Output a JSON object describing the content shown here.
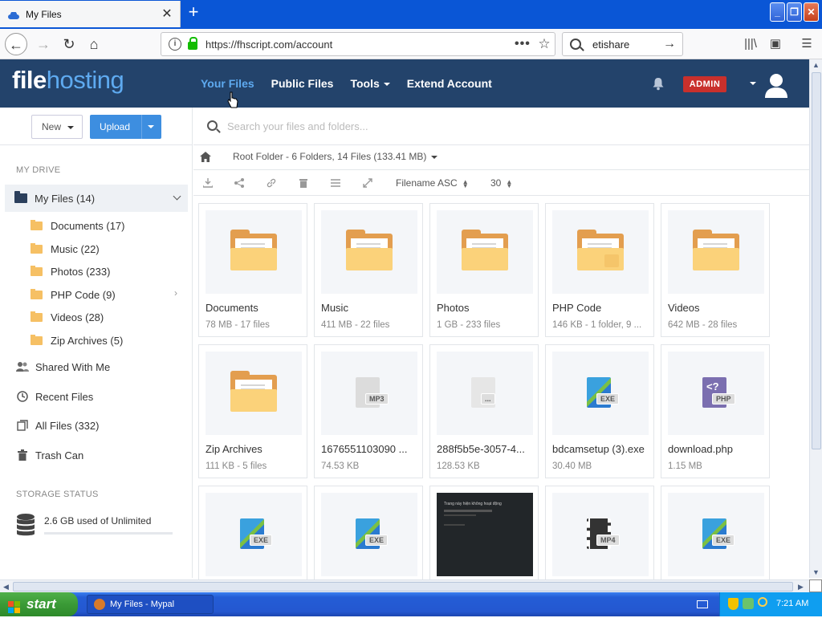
{
  "browser": {
    "tab_title": "My Files",
    "new_tab": "+",
    "url": "https://fhscript.com/account",
    "search_query": "etishare"
  },
  "header": {
    "logo_part1": "file",
    "logo_part2": "hosting",
    "nav": {
      "your_files": "Your Files",
      "public_files": "Public Files",
      "tools": "Tools",
      "extend_account": "Extend Account"
    },
    "admin_badge": "ADMIN"
  },
  "sidebar": {
    "new_label": "New",
    "upload_label": "Upload",
    "my_drive_label": "MY DRIVE",
    "my_files": "My Files (14)",
    "folders": [
      "Documents (17)",
      "Music (22)",
      "Photos (233)",
      "PHP Code (9)",
      "Videos (28)",
      "Zip Archives (5)"
    ],
    "links": {
      "shared": "Shared With Me",
      "recent": "Recent Files",
      "all": "All Files (332)",
      "trash": "Trash Can"
    },
    "storage_label": "STORAGE STATUS",
    "storage_text": "2.6 GB used of Unlimited"
  },
  "main": {
    "search_placeholder": "Search your files and folders...",
    "breadcrumb": "Root Folder - 6 Folders, 14 Files (133.41 MB)",
    "sort_label": "Filename ASC",
    "per_page": "30",
    "items": [
      {
        "name": "Documents",
        "meta": "78 MB - 17 files"
      },
      {
        "name": "Music",
        "meta": "411 MB - 22 files"
      },
      {
        "name": "Photos",
        "meta": "1 GB - 233 files"
      },
      {
        "name": "PHP Code",
        "meta": "146 KB - 1 folder, 9 ..."
      },
      {
        "name": "Videos",
        "meta": "642 MB - 28 files"
      },
      {
        "name": "Zip Archives",
        "meta": "111 KB - 5 files"
      },
      {
        "name": "1676551103090 ...",
        "meta": "74.53 KB"
      },
      {
        "name": "288f5b5e-3057-4...",
        "meta": "128.53 KB"
      },
      {
        "name": "bdcamsetup (3).exe",
        "meta": "30.40 MB"
      },
      {
        "name": "download.php",
        "meta": "1.15 MB"
      }
    ],
    "file_labels": {
      "mp3": "MP3",
      "exe": "EXE",
      "php": "PHP",
      "mp4": "MP4",
      "blank": "..."
    },
    "screenshot_text": "Trang này hiện không hoạt động"
  },
  "taskbar": {
    "start": "start",
    "window": "My Files - Mypal",
    "clock": "7:21 AM"
  },
  "colors": {
    "header_bg": "#23436b",
    "accent": "#5eaaf0",
    "upload_btn": "#3d8ee0",
    "admin_badge": "#c9302c",
    "folder": "#fbd27a"
  }
}
